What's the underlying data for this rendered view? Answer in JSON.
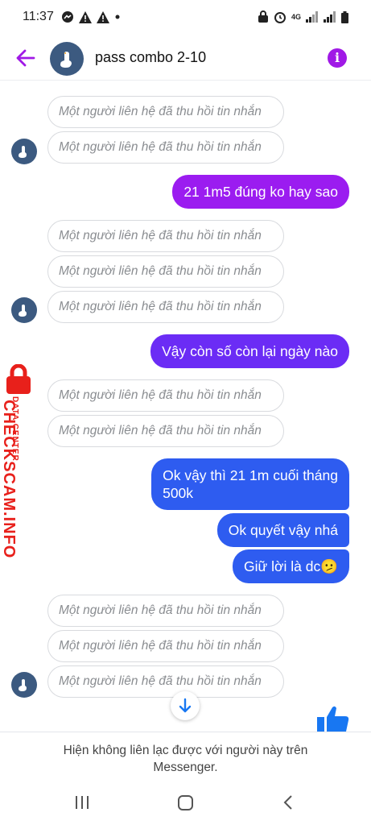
{
  "status": {
    "time": "11:37",
    "network": "4G"
  },
  "header": {
    "title": "pass combo 2-10"
  },
  "recalled_text": "Một người liên hệ đã thu hồi tin nhắn",
  "messages": {
    "out1": "21 1m5 đúng ko hay sao",
    "out2": "Vậy còn số còn lại ngày nào",
    "out3_line1": "Ok vậy thì 21 1m cuối tháng",
    "out3_line2": "500k",
    "out4": "Ok quyết vậy nhá",
    "out5": "Giữ lời là dc",
    "out5_emoji": "🫤"
  },
  "watermark": {
    "top": "DATA CENTER",
    "brand": "CHECKSCAM.INFO"
  },
  "footer": {
    "line1": "Hiện không liên lạc được với người này trên",
    "line2": "Messenger."
  },
  "colors": {
    "accent": "#a019e6",
    "purple_bubble": "#9b1cf0",
    "indigo_bubble": "#6b2cf5",
    "blue_bubble": "#2e5cf0",
    "watermark": "#e8201b"
  },
  "icons": [
    "back-arrow-icon",
    "info-icon",
    "arrow-down-icon",
    "like-icon",
    "goose-avatar-icon"
  ]
}
